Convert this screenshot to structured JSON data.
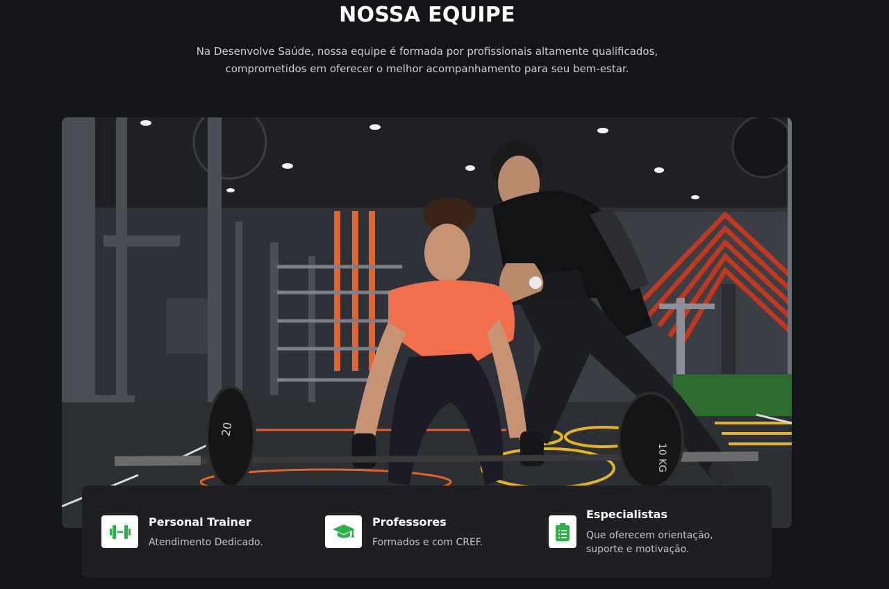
{
  "section": {
    "title": "NOSSA EQUIPE",
    "subtitle_line1": "Na Desenvolve Saúde, nossa equipe é formada por profissionais altamente qualificados,",
    "subtitle_line2": "comprometidos em oferecer o melhor acompanhamento para seu bem-estar."
  },
  "image": {
    "subject": "personal trainer coaching a woman lifting a barbell in a gym",
    "plate_left_label": "20",
    "plate_right_label": "10 KG"
  },
  "features": [
    {
      "icon": "dumbbell-icon",
      "title": "Personal Trainer",
      "description": "Atendimento Dedicado."
    },
    {
      "icon": "graduation-cap-icon",
      "title": "Professores",
      "description": "Formados e com CREF."
    },
    {
      "icon": "clipboard-icon",
      "title": "Especialistas",
      "description": "Que oferecem orientação, suporte e motivação."
    }
  ],
  "colors": {
    "background": "#141519",
    "card": "#1e1f23",
    "accent_green": "#2bb34a",
    "text_muted": "#c4c5c9"
  }
}
